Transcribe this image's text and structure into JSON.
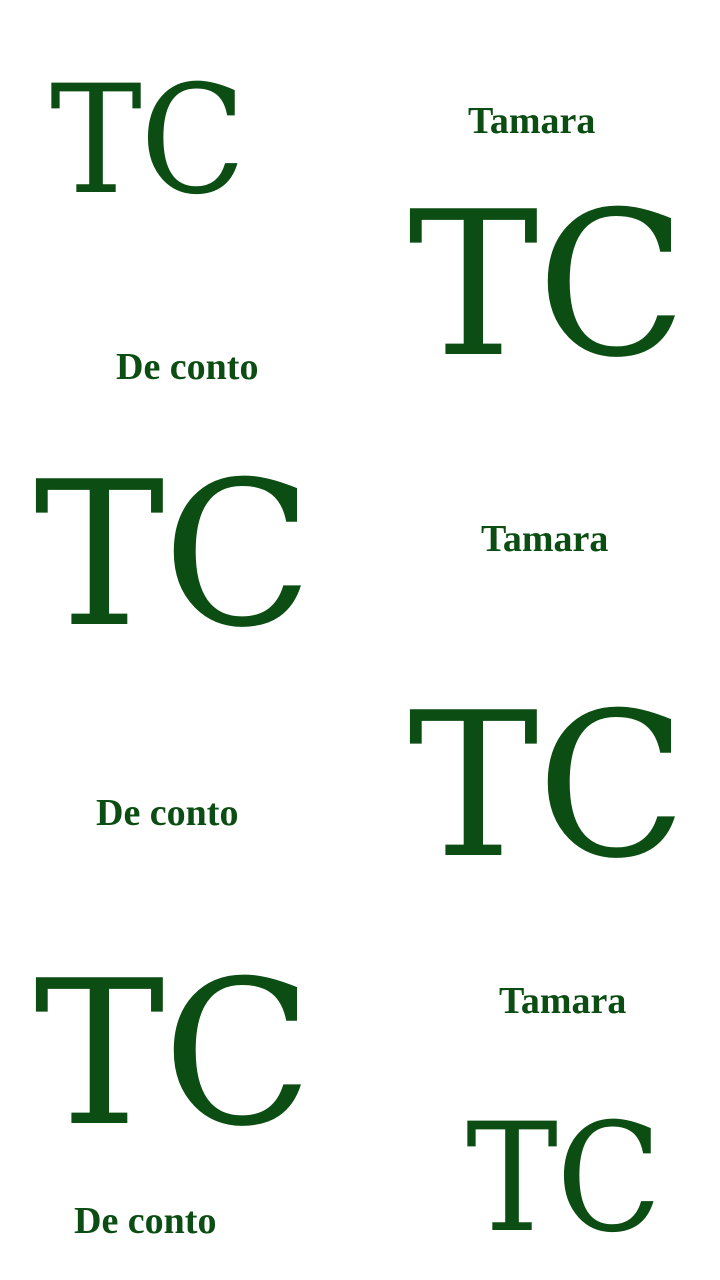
{
  "pattern": {
    "accent_color": "#0b4d12",
    "background_color": "#ffffff",
    "monograms": [
      "TC",
      "TC",
      "TC",
      "TC",
      "TC",
      "TC"
    ],
    "words": [
      "Tamara",
      "De conto",
      "Tamara",
      "De conto",
      "Tamara",
      "De conto"
    ]
  }
}
